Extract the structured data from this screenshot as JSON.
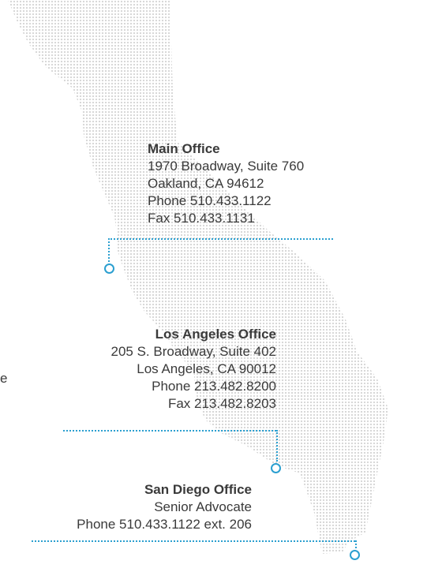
{
  "offices": {
    "main": {
      "name": "Main Office",
      "lines": [
        "1970 Broadway, Suite 760",
        "Oakland, CA 94612",
        "Phone 510.433.1122",
        "Fax 510.433.1131"
      ]
    },
    "la": {
      "name": "Los Angeles Office",
      "lines": [
        "205 S. Broadway, Suite 402",
        "Los Angeles, CA 90012",
        "Phone 213.482.8200",
        "Fax 213.482.8203"
      ]
    },
    "sd": {
      "name": "San Diego Office",
      "lines": [
        "Senior Advocate",
        "Phone 510.433.1122 ext. 206"
      ]
    }
  },
  "edge_fragment": "e",
  "colors": {
    "accent": "#2b9fd0",
    "dots": "#d6d6d6",
    "text": "#3a3a3a"
  },
  "map": {
    "region": "California",
    "pins": [
      "main",
      "la",
      "sd"
    ]
  }
}
